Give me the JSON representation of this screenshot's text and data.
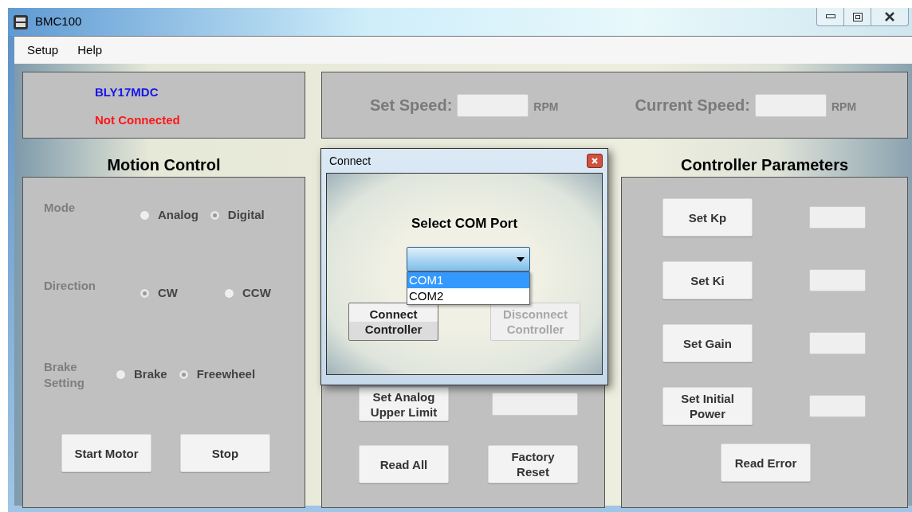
{
  "window": {
    "title": "BMC100"
  },
  "menu": [
    {
      "label": "Setup"
    },
    {
      "label": "Help"
    }
  ],
  "status_panel": {
    "model": "BLY17MDC",
    "connection": "Not Connected"
  },
  "speed_panel": {
    "fields": [
      {
        "label": "Set Speed:",
        "unit": "RPM",
        "disabled": true
      },
      {
        "label": "Current Speed:",
        "unit": "RPM",
        "disabled": true
      }
    ]
  },
  "motion_control": {
    "title": "Motion Control",
    "groups": [
      {
        "label": "Mode",
        "options": [
          {
            "label": "Analog",
            "selected": false
          },
          {
            "label": "Digital",
            "selected": true
          }
        ]
      },
      {
        "label": "Direction",
        "options": [
          {
            "label": "CW",
            "selected": true
          },
          {
            "label": "CCW",
            "selected": false
          }
        ]
      },
      {
        "label": "Brake Setting",
        "options": [
          {
            "label": "Brake",
            "selected": false
          },
          {
            "label": "Freewheel",
            "selected": true
          }
        ]
      }
    ],
    "buttons": [
      {
        "label": "Start Motor"
      },
      {
        "label": "Stop"
      }
    ]
  },
  "motor_parameters": {
    "rows": [
      {
        "button": "Set Analog Upper Limit"
      }
    ],
    "buttons": [
      {
        "label": "Read All"
      },
      {
        "label": "Factory Reset"
      }
    ]
  },
  "controller_parameters": {
    "title": "Controller Parameters",
    "rows": [
      {
        "button": "Set Kp"
      },
      {
        "button": "Set Ki"
      },
      {
        "button": "Set Gain"
      },
      {
        "button": "Set Initial Power"
      }
    ],
    "buttons": [
      {
        "label": "Read Error"
      }
    ]
  },
  "connect_dialog": {
    "title": "Connect",
    "heading": "Select COM Port",
    "dropdown": {
      "expanded": true,
      "options": [
        {
          "label": "COM1",
          "selected": true
        },
        {
          "label": "COM2",
          "selected": false
        }
      ]
    },
    "buttons": [
      {
        "label": "Connect Controller",
        "disabled": false
      },
      {
        "label": "Disconnect Controller",
        "disabled": true
      }
    ]
  }
}
